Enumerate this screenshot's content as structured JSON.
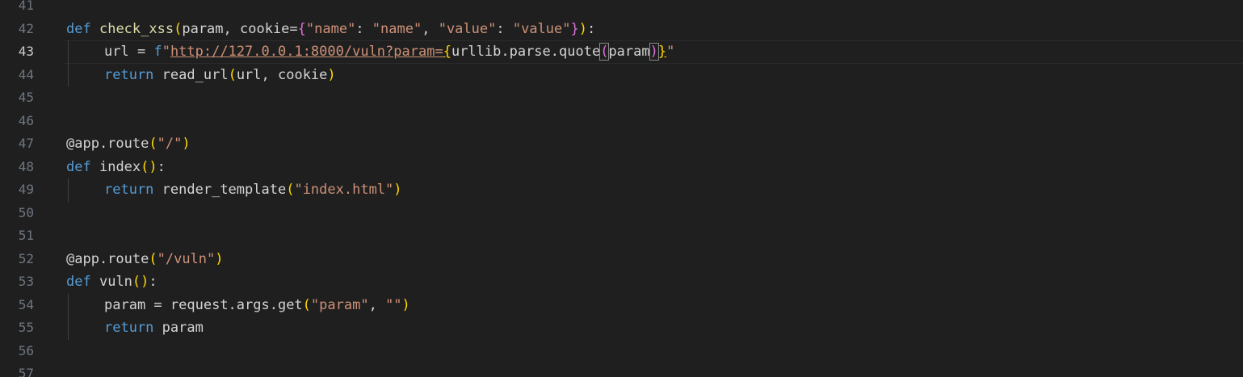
{
  "editor": {
    "line_numbers": [
      "41",
      "42",
      "43",
      "44",
      "45",
      "46",
      "47",
      "48",
      "49",
      "50",
      "51",
      "52",
      "53",
      "54",
      "55",
      "56",
      "57"
    ],
    "active_line": "43",
    "code": {
      "l42": {
        "def": "def",
        "name": "check_xss",
        "open": "(",
        "params": "param, cookie=",
        "brace_open": "{",
        "k1": "\"name\"",
        "colon1": ": ",
        "v1": "\"name\"",
        "comma": ", ",
        "k2": "\"value\"",
        "colon2": ": ",
        "v2": "\"value\"",
        "brace_close": "}",
        "close": ")",
        "end": ":"
      },
      "l43": {
        "var": "url",
        "eq": " = ",
        "prefix": "f",
        "str_start": "\"",
        "url": "http://127.0.0.1:8000/vuln?param=",
        "brace_open": "{",
        "expr": "urllib.parse.quote",
        "popen": "(",
        "arg": "param",
        "pclose": ")",
        "brace_close": "}",
        "str_end": "\""
      },
      "l44": {
        "ret": "return",
        "call": "read_url",
        "open": "(",
        "args": "url, cookie",
        "close": ")"
      },
      "l47": {
        "deco": "@app.route",
        "open": "(",
        "arg": "\"/\"",
        "close": ")"
      },
      "l48": {
        "def": "def",
        "name": "index",
        "parens": "()",
        "end": ":"
      },
      "l49": {
        "ret": "return",
        "call": "render_template",
        "open": "(",
        "arg": "\"index.html\"",
        "close": ")"
      },
      "l52": {
        "deco": "@app.route",
        "open": "(",
        "arg": "\"/vuln\"",
        "close": ")"
      },
      "l53": {
        "def": "def",
        "name": "vuln",
        "parens": "()",
        "end": ":"
      },
      "l54": {
        "var": "param",
        "eq": " = ",
        "obj": "request.args.get",
        "open": "(",
        "a1": "\"param\"",
        "sep": ", ",
        "a2": "\"\"",
        "close": ")"
      },
      "l55": {
        "ret": "return",
        "var": "param"
      }
    }
  },
  "colors": {
    "background": "#1f1f1f",
    "keyword": "#569cd6",
    "function": "#dcdcaa",
    "string": "#ce9178",
    "bracket_level1": "#ffd700",
    "bracket_level2": "#da70d6"
  }
}
